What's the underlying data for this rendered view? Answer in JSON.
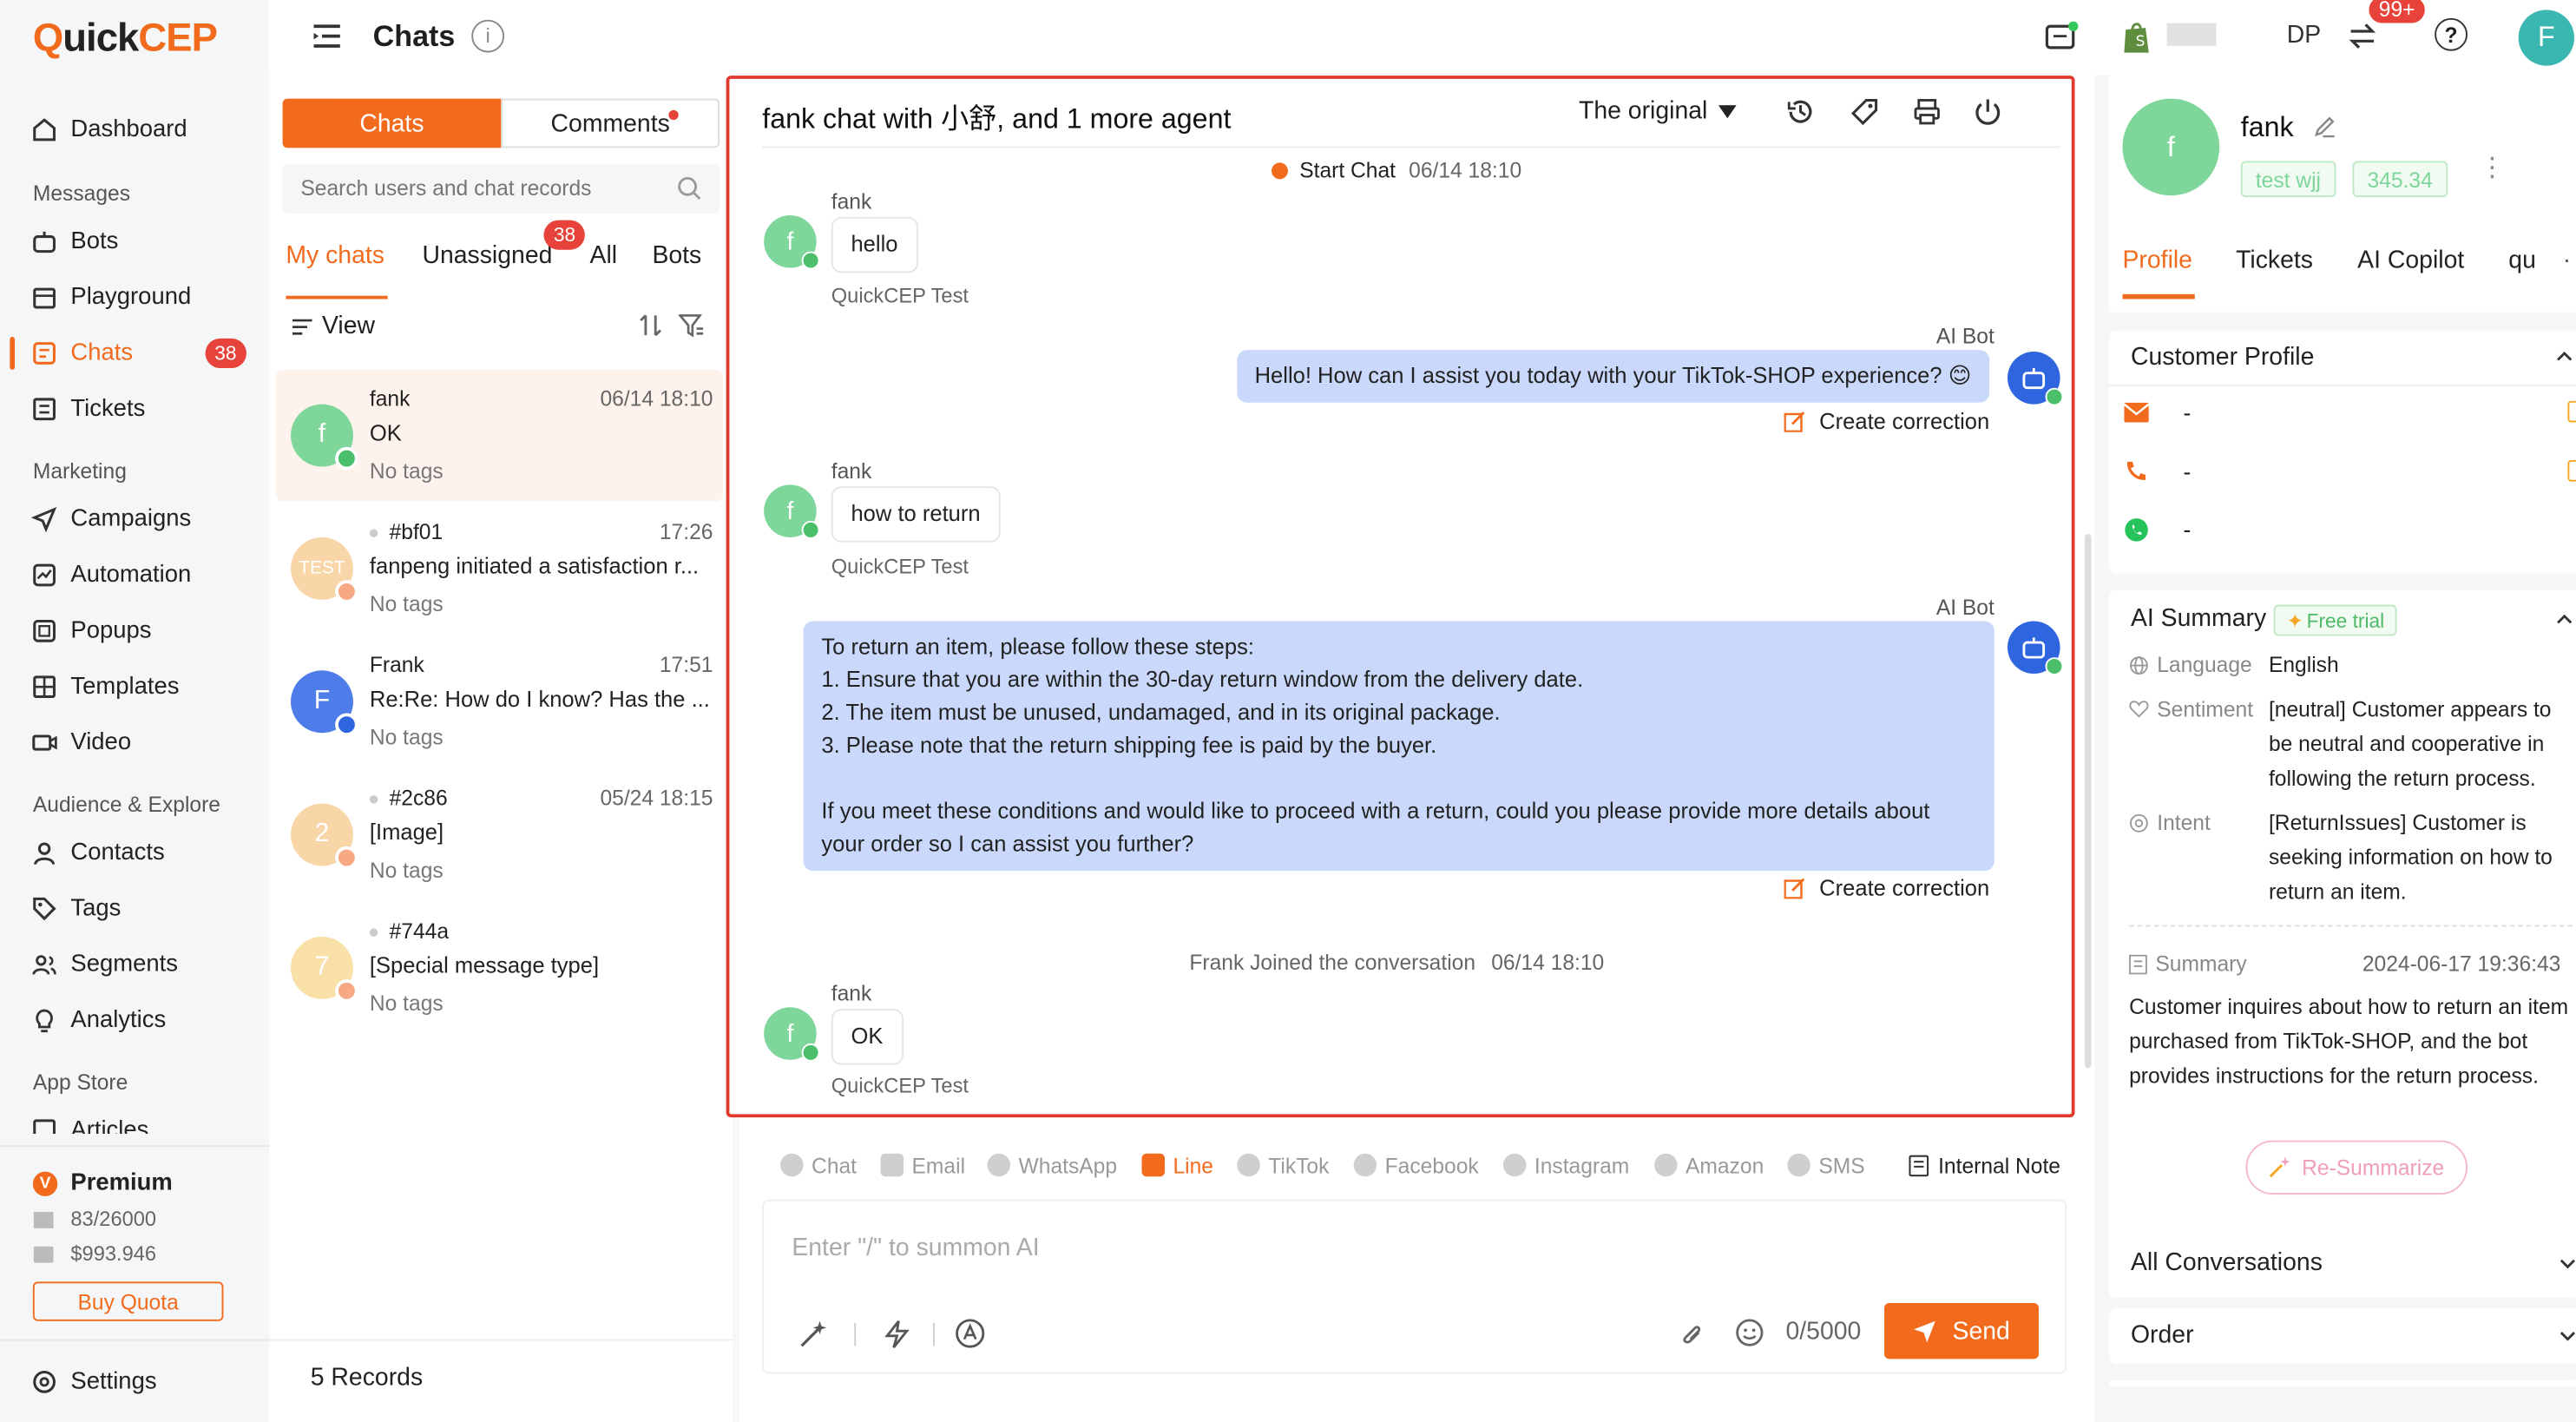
{
  "brand": {
    "logo": "QuickCEP"
  },
  "header": {
    "title": "Chats",
    "badge_notif": "99+",
    "user_initial": "F",
    "store_fragment": "DP"
  },
  "sidebar": {
    "dashboard": "Dashboard",
    "sec_messages": "Messages",
    "bots": "Bots",
    "playground": "Playground",
    "chats": "Chats",
    "chats_badge": "38",
    "tickets": "Tickets",
    "sec_marketing": "Marketing",
    "campaigns": "Campaigns",
    "automation": "Automation",
    "popups": "Popups",
    "templates": "Templates",
    "video": "Video",
    "sec_audience": "Audience & Explore",
    "contacts": "Contacts",
    "tags": "Tags",
    "segments": "Segments",
    "analytics": "Analytics",
    "sec_appstore": "App Store",
    "articles": "Articles",
    "plan": "Premium",
    "plan_badge": "V",
    "quota_msgs": "83/26000",
    "quota_money": "$993.946",
    "buy_quota": "Buy Quota",
    "settings": "Settings"
  },
  "chatlist": {
    "tab_chats": "Chats",
    "tab_comments": "Comments",
    "search_placeholder": "Search users and chat records",
    "filter_my": "My chats",
    "filter_unassigned": "Unassigned",
    "unassigned_badge": "38",
    "filter_all": "All",
    "filter_bots": "Bots",
    "view": "View",
    "records": "5 Records",
    "items": [
      {
        "name": "fank",
        "time": "06/14 18:10",
        "msg": "OK",
        "tags": "No tags",
        "avatar": "f",
        "color": "#7ed69b"
      },
      {
        "name": "#bf01",
        "time": "17:26",
        "msg": "fanpeng initiated a satisfaction r...",
        "tags": "No tags",
        "avatar": "TEST",
        "color": "#f8d6a8"
      },
      {
        "name": "Frank",
        "time": "17:51",
        "msg": "Re:Re: How do I know? Has the ...",
        "tags": "No tags",
        "avatar": "F",
        "color": "#4e7ce8"
      },
      {
        "name": "#2c86",
        "time": "05/24 18:15",
        "msg": "[Image]",
        "tags": "No tags",
        "avatar": "2",
        "color": "#f8d6a8"
      },
      {
        "name": "#744a",
        "time": "",
        "msg": "[Special message type]",
        "tags": "No tags",
        "avatar": "7",
        "color": "#f9e0a8"
      }
    ]
  },
  "chat": {
    "title": "fank chat with 小舒, and 1 more agent",
    "translate": "The original",
    "start_chat": "Start Chat",
    "start_time": "06/14 18:10",
    "msg1_name": "fank",
    "msg1_text": "hello",
    "msg1_sub": "QuickCEP Test",
    "bot1_name": "AI Bot",
    "bot1_text": "Hello! How can I assist you today with your TikTok-SHOP experience? 😊",
    "create_correction": "Create correction",
    "msg2_name": "fank",
    "msg2_text": "how to return",
    "msg2_sub": "QuickCEP Test",
    "bot2_name": "AI Bot",
    "bot2_lines": [
      "To return an item, please follow these steps:",
      "1. Ensure that you are within the 30-day return window from the delivery date.",
      "2. The item must be unused, undamaged, and in its original package.",
      "3. Please note that the return shipping fee is paid by the buyer.",
      "",
      "If you meet these conditions and would like to proceed with a return, could you please provide more details about",
      "your order so I can assist you further?"
    ],
    "joined": "Frank Joined the conversation",
    "joined_time": "06/14 18:10",
    "msg3_name": "fank",
    "msg3_text": "OK",
    "msg3_sub": "QuickCEP Test"
  },
  "composer": {
    "channels": [
      "Chat",
      "Email",
      "WhatsApp",
      "Line",
      "TikTok",
      "Facebook",
      "Instagram",
      "Amazon",
      "SMS"
    ],
    "active_channel": "Line",
    "internal_note": "Internal Note",
    "placeholder": "Enter \"/\" to summon AI",
    "counter": "0/5000",
    "send": "Send"
  },
  "profile": {
    "name": "fank",
    "avatar": "f",
    "tag1": "test wjj",
    "tag2": "345.34",
    "tabs": [
      "Profile",
      "Tickets",
      "AI Copilot",
      "qu"
    ],
    "customer_profile": "Customer Profile",
    "email": "-",
    "phone": "-",
    "whatsapp": "-",
    "ai_summary": "AI Summary",
    "free_trial": "Free trial",
    "language_label": "Language",
    "language": "English",
    "sentiment_label": "Sentiment",
    "sentiment": "[neutral] Customer appears to be neutral and cooperative in following the return process.",
    "intent_label": "Intent",
    "intent": "[ReturnIssues] Customer is seeking information on how to return an item.",
    "summary_label": "Summary",
    "summary_time": "2024-06-17 19:36:43",
    "summary": "Customer inquires about how to return an item purchased from TikTok-SHOP, and the bot provides instructions for the return process.",
    "resummarize": "Re-Summarize",
    "all_conversations": "All Conversations",
    "order": "Order"
  },
  "colors": {
    "accent": "#f26b1d",
    "bot_bubble": "#cad9fb",
    "highlight_border": "#e03a2f",
    "badge": "#e8433a",
    "green": "#7ed69b"
  }
}
